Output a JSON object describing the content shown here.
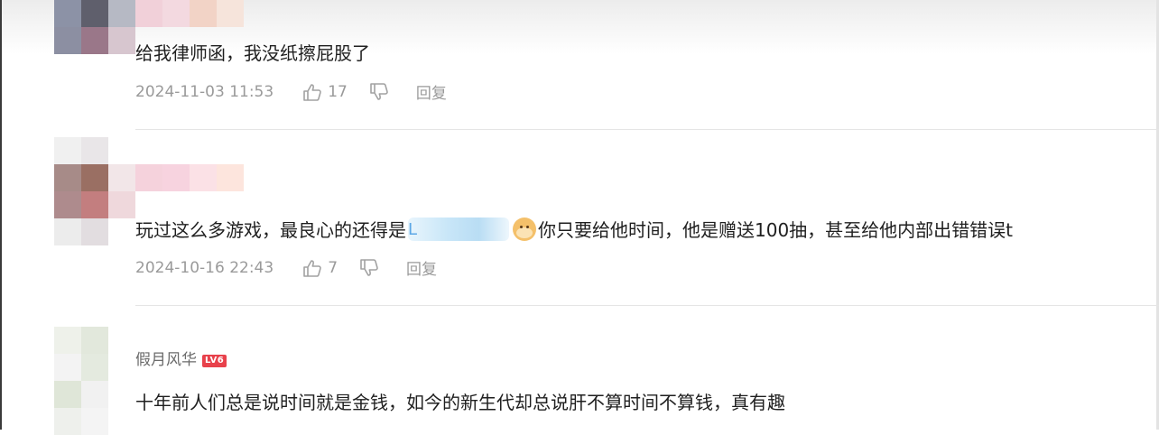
{
  "comments": [
    {
      "text": "给我律师函，我没纸擦屁股了",
      "date": "2024-11-03 11:53",
      "likes": "17",
      "reply_label": "回复",
      "avatar_colors": [
        "#8c92a6",
        "#5f5f6c",
        "#b6b9c4",
        "#f1d0d9",
        "#f3d9e0",
        "#f2d3c6",
        "#f6e4db",
        "#8c8fa2",
        "#9a7789",
        "#d7c6cf"
      ]
    },
    {
      "text_before": "玩过这么多游戏，最良心的还得是",
      "link_visible": "L",
      "text_after": "你只要给他时间，他是赠送100抽，甚至给他内部出错错误t",
      "date": "2024-10-16 22:43",
      "likes": "7",
      "reply_label": "回复",
      "avatar_colors": [
        "#f0f0f0",
        "#e9e6e8",
        "#a78b88",
        "#9a6f63",
        "#f2e6e8",
        "#f5d2dc",
        "#f7d3df",
        "#fbe1e6",
        "#fde5dd",
        "#ae8b8d",
        "#c37e7f",
        "#efd8dc",
        "#ececec",
        "#e2dde0"
      ]
    },
    {
      "username": "假月风华",
      "level_badge": "LV6",
      "text": "十年前人们总是说时间就是金钱，如今的新生代却总说肝不算时间不算钱，真有趣",
      "avatar_colors": [
        "#eef1ea",
        "#e2e8dc",
        "#f3f3f3",
        "#e4eadf",
        "#dfe6d8",
        "#f1f1f1",
        "#eef0ec",
        "#f4f4f4"
      ]
    }
  ],
  "icons": {
    "like": "thumbs-up-icon",
    "dislike": "thumbs-down-icon",
    "emoji": "dog-emoji-icon"
  },
  "colors": {
    "meta_text": "#9a9a9a",
    "level_badge": "#e8414b",
    "link_blue": "#5ba7e6"
  }
}
